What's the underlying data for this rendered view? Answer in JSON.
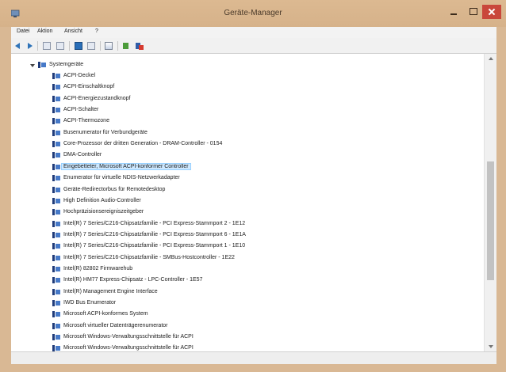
{
  "window": {
    "title": "Geräte-Manager",
    "accent_color": "#d9b894",
    "close_color": "#c9473b"
  },
  "menu": {
    "items": [
      "Datei",
      "Aktion",
      "Ansicht",
      "?"
    ]
  },
  "toolbar": {
    "icons": [
      "back-arrow-icon",
      "forward-arrow-icon",
      "show-hide-tree-icon",
      "properties-icon",
      "help-icon",
      "view-icon",
      "scan-hardware-icon",
      "update-driver-icon",
      "uninstall-device-icon"
    ]
  },
  "tree": {
    "category": {
      "label": "Systemgeräte",
      "expanded": true
    },
    "selected_index": 8,
    "items": [
      "ACPI-Deckel",
      "ACPI-Einschaltknopf",
      "ACPI-Energiezustandknopf",
      "ACPI-Schalter",
      "ACPI-Thermozone",
      "Busenumerator für Verbundgeräte",
      "Core-Prozessor der dritten Generation - DRAM-Controller - 0154",
      "DMA-Controller",
      "Eingebetteter, Microsoft ACPI-konformer Controller",
      "Enumerator für virtuelle NDIS-Netzwerkadapter",
      "Geräte-Redirectorbus für Remotedesktop",
      "High Definition Audio-Controller",
      "Hochpräzisionsereigniszeitgeber",
      "Intel(R) 7 Series/C216-Chipsatzfamilie - PCI Express-Stammport 2 - 1E12",
      "Intel(R) 7 Series/C216-Chipsatzfamilie - PCI Express-Stammport 6 - 1E1A",
      "Intel(R) 7 Series/C216-Chipsatzfamilie - PCI Express-Stammport 1 - 1E10",
      "Intel(R) 7 Series/C216-Chipsatzfamilie - SMBus-Hostcontroller - 1E22",
      "Intel(R) 82802 Firmwarehub",
      "Intel(R) HM77 Express-Chipsatz - LPC-Controller - 1E57",
      "Intel(R) Management Engine Interface",
      "IWD Bus Enumerator",
      "Microsoft ACPI-konformes System",
      "Microsoft virtueller Datenträgerenumerator",
      "Microsoft Windows-Verwaltungsschnittstelle für ACPI",
      "Microsoft Windows-Verwaltungsschnittstelle für ACPI"
    ]
  }
}
